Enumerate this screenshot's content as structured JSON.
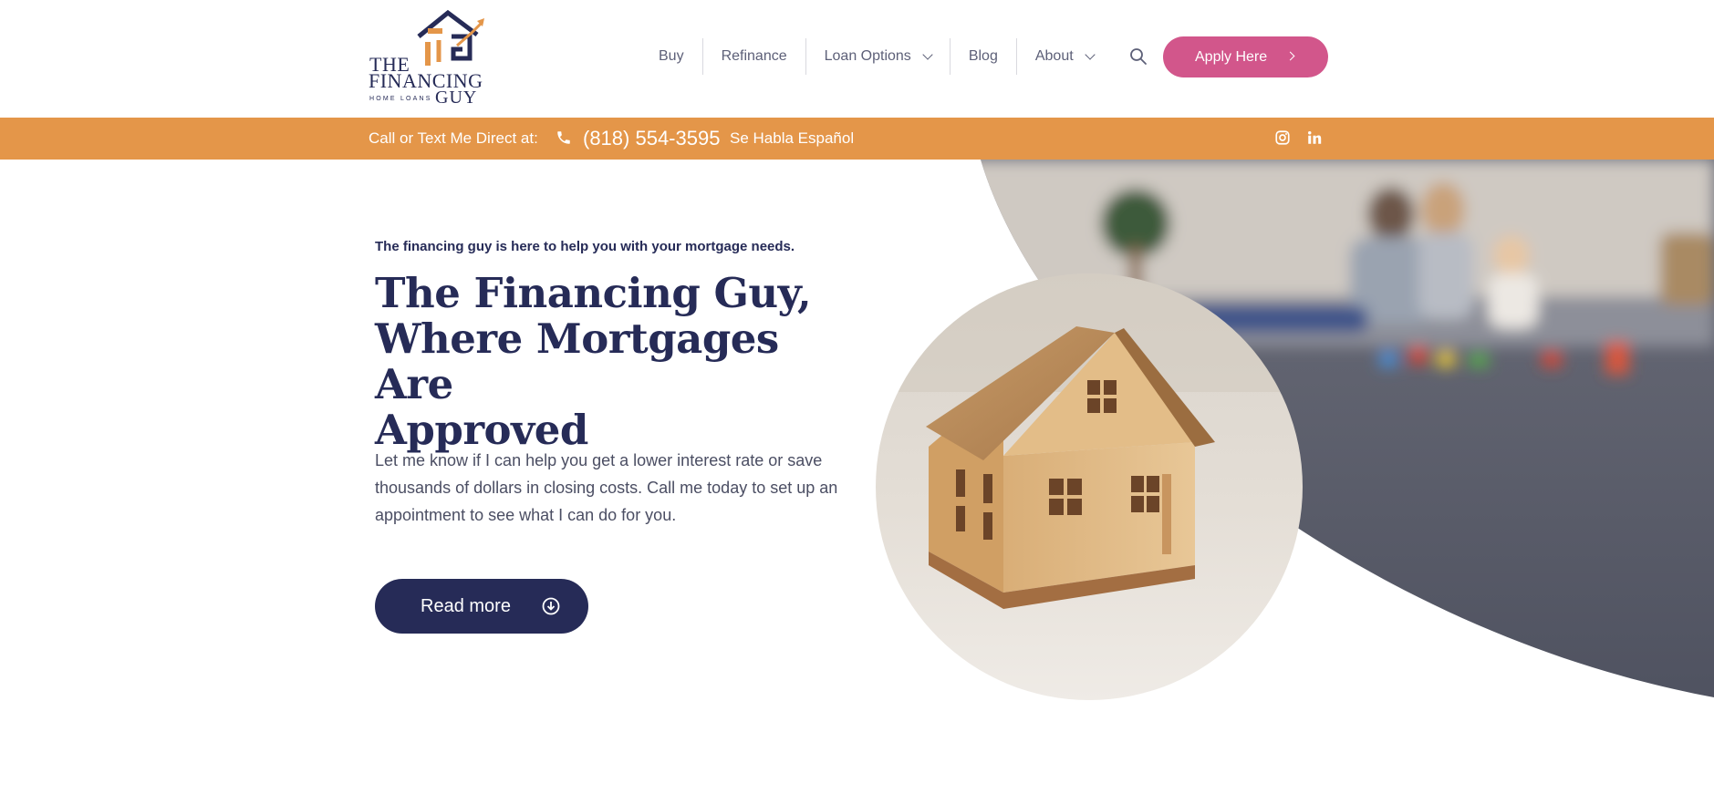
{
  "logo": {
    "line1": "THE",
    "line2": "FINANCING",
    "line3": "GUY",
    "tagline": "HOME LOANS"
  },
  "nav": {
    "items": [
      {
        "label": "Buy"
      },
      {
        "label": "Refinance"
      },
      {
        "label": "Loan Options"
      },
      {
        "label": "Blog"
      },
      {
        "label": "About"
      }
    ],
    "search_icon": "search-icon",
    "apply_label": "Apply Here"
  },
  "topbar": {
    "call_label": "Call or Text Me Direct at:",
    "phone": "(818) 554-3595",
    "spanish": "Se Habla Español",
    "icons": [
      "phone-icon",
      "instagram-icon",
      "linkedin-icon"
    ]
  },
  "hero": {
    "eyebrow": "The financing guy is here to help you with your mortgage needs.",
    "title_line1": "The Financing Guy,",
    "title_line2": "Where Mortgages Are",
    "title_line3": "Approved",
    "body": "Let me know if I can help you get a lower interest rate or save thousands of dollars in closing costs. Call me today to set up an appointment to see what I can do for you.",
    "cta_label": "Read more"
  },
  "colors": {
    "navy": "#262b57",
    "orange": "#e49649",
    "pink": "#d2568b",
    "gray_shape": "#5c5f6e"
  }
}
